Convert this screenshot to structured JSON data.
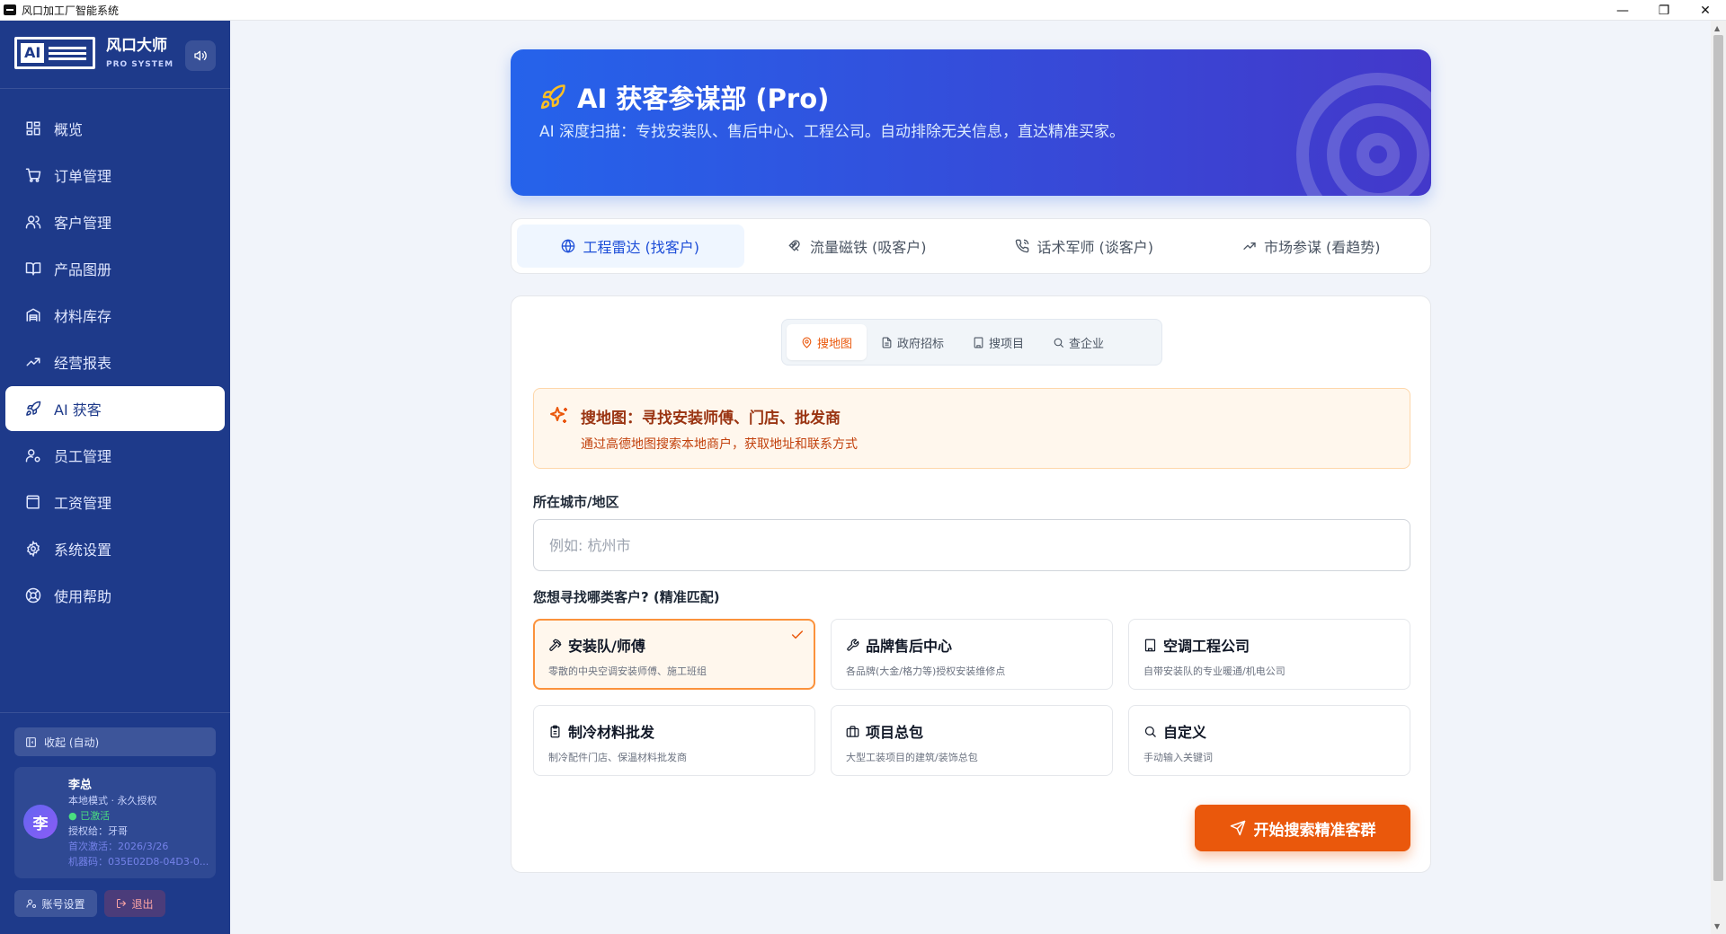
{
  "window": {
    "title": "风口加工厂智能系统"
  },
  "brand": {
    "logo_text": "AI",
    "name": "风口大师",
    "subtitle": "PRO SYSTEM"
  },
  "nav": {
    "items": [
      {
        "label": "概览",
        "icon": "grid-icon"
      },
      {
        "label": "订单管理",
        "icon": "cart-icon"
      },
      {
        "label": "客户管理",
        "icon": "users-icon"
      },
      {
        "label": "产品图册",
        "icon": "book-icon"
      },
      {
        "label": "材料库存",
        "icon": "warehouse-icon"
      },
      {
        "label": "经营报表",
        "icon": "trend-icon"
      },
      {
        "label": "AI 获客",
        "icon": "rocket-icon",
        "active": true
      },
      {
        "label": "员工管理",
        "icon": "user-cog-icon"
      },
      {
        "label": "工资管理",
        "icon": "wallet-icon"
      },
      {
        "label": "系统设置",
        "icon": "gear-icon"
      },
      {
        "label": "使用帮助",
        "icon": "lifebuoy-icon"
      }
    ]
  },
  "sidebar_footer": {
    "collapse_label": "收起 (自动)",
    "user": {
      "avatar": "李",
      "name": "李总",
      "mode": "本地模式 · 永久授权",
      "status": "● 已激活",
      "licensee": "授权给：牙哥",
      "first_activation": "首次激活：2026/3/26",
      "machine_code": "机器码：035E02D8-04D3-0..."
    },
    "account_label": "账号设置",
    "logout_label": "退出"
  },
  "hero": {
    "title": "AI 获客参谋部 (Pro)",
    "description": "AI 深度扫描：专找安装队、售后中心、工程公司。自动排除无关信息，直达精准买家。"
  },
  "tabs": [
    {
      "label": "工程雷达 (找客户)",
      "icon": "globe-icon",
      "active": true
    },
    {
      "label": "流量磁铁 (吸客户)",
      "icon": "magnet-icon"
    },
    {
      "label": "话术军师 (谈客户)",
      "icon": "phone-icon"
    },
    {
      "label": "市场参谋 (看趋势)",
      "icon": "trend-icon"
    }
  ],
  "subtabs": [
    {
      "label": "搜地图",
      "icon": "map-pin-icon",
      "active": true
    },
    {
      "label": "政府招标",
      "icon": "document-icon"
    },
    {
      "label": "搜项目",
      "icon": "building-icon"
    },
    {
      "label": "查企业",
      "icon": "search-icon"
    }
  ],
  "info": {
    "title": "搜地图：寻找安装师傅、门店、批发商",
    "desc": "通过高德地图搜索本地商户，获取地址和联系方式"
  },
  "form": {
    "city_label": "所在城市/地区",
    "city_placeholder": "例如: 杭州市",
    "city_value": "",
    "type_label": "您想寻找哪类客户? (精准匹配)"
  },
  "options": [
    {
      "title": "安装队/师傅",
      "desc": "零散的中央空调安装师傅、施工班组",
      "icon": "hammer-icon",
      "selected": true
    },
    {
      "title": "品牌售后中心",
      "desc": "各品牌(大金/格力等)授权安装维修点",
      "icon": "wrench-icon"
    },
    {
      "title": "空调工程公司",
      "desc": "自带安装队的专业暖通/机电公司",
      "icon": "building-icon"
    },
    {
      "title": "制冷材料批发",
      "desc": "制冷配件门店、保温材料批发商",
      "icon": "clipboard-icon"
    },
    {
      "title": "项目总包",
      "desc": "大型工装项目的建筑/装饰总包",
      "icon": "briefcase-icon"
    },
    {
      "title": "自定义",
      "desc": "手动输入关键词",
      "icon": "search-icon"
    }
  ],
  "start_button": "开始搜索精准客群",
  "colors": {
    "sidebar": "#1e3a8a",
    "accent": "#ea580c",
    "primary": "#2563eb"
  }
}
